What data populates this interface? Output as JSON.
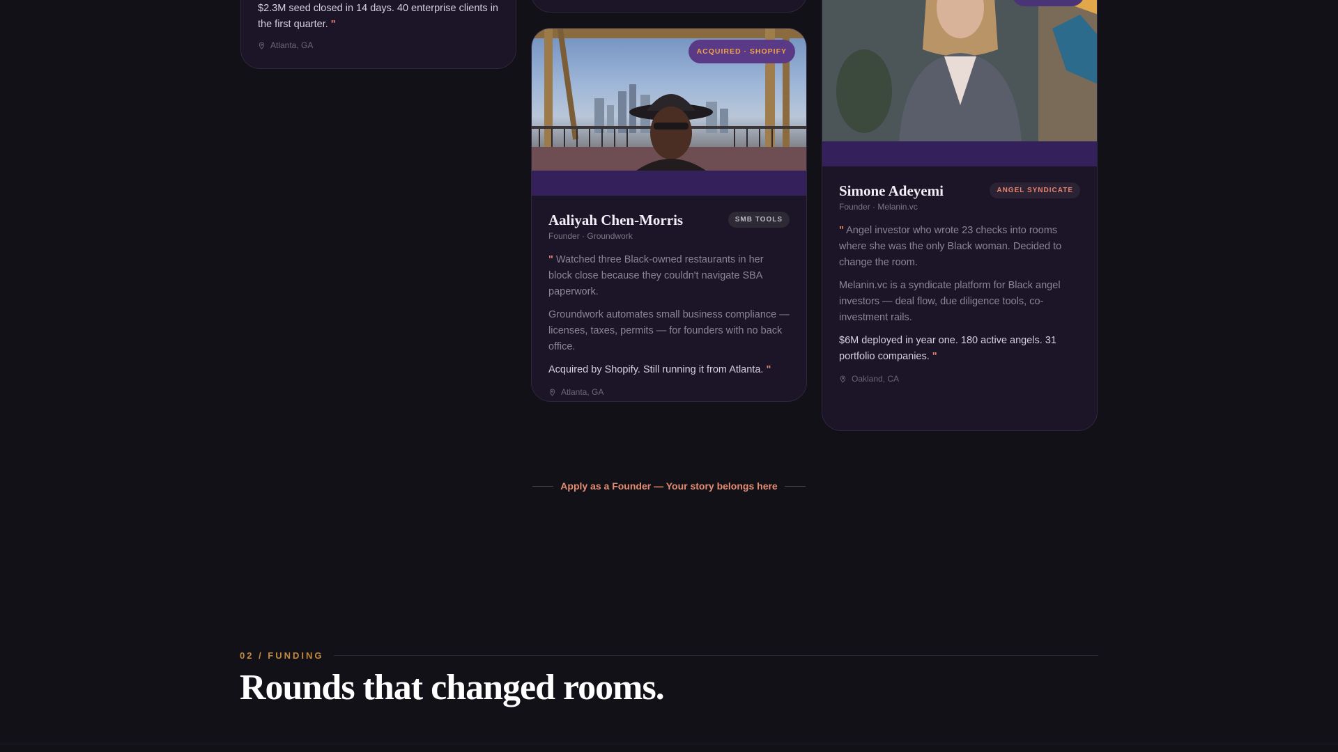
{
  "cards": {
    "left": {
      "outcome": "$2.3M seed closed in 14 days. 40 enterprise clients in the first quarter.",
      "quote_close": "\"",
      "location": "Atlanta, GA"
    },
    "middle": {
      "photo_badge": "ACQUIRED · SHOPIFY",
      "name": "Aaliyah Chen-Morris",
      "role": "Founder · Groundwork",
      "tag": "SMB TOOLS",
      "quote_open": "\"",
      "quote": "Watched three Black-owned restaurants in her block close because they couldn't navigate SBA paperwork.",
      "description": "Groundwork automates small business compliance — licenses, taxes, permits — for founders with no back office.",
      "outcome": "Acquired by Shopify. Still running it from Atlanta.",
      "quote_close": "\"",
      "location": "Atlanta, GA"
    },
    "right": {
      "name": "Simone Adeyemi",
      "role": "Founder · Melanin.vc",
      "tag": "ANGEL SYNDICATE",
      "quote_open": "\"",
      "quote": "Angel investor who wrote 23 checks into rooms where she was the only Black woman. Decided to change the room.",
      "description": "Melanin.vc is a syndicate platform for Black angel investors — deal flow, due diligence tools, co-investment rails.",
      "outcome": "$6M deployed in year one. 180 active angels. 31 portfolio companies.",
      "quote_close": "\"",
      "location": "Oakland, CA"
    }
  },
  "apply_link": "Apply as a Founder — Your story belongs here",
  "section": {
    "eyebrow": "02 / FUNDING",
    "heading": "Rounds that changed rooms."
  },
  "colors": {
    "background": "#121118",
    "card": "#1b1527",
    "accent": "#e8836f",
    "gold": "#c48a3b"
  }
}
